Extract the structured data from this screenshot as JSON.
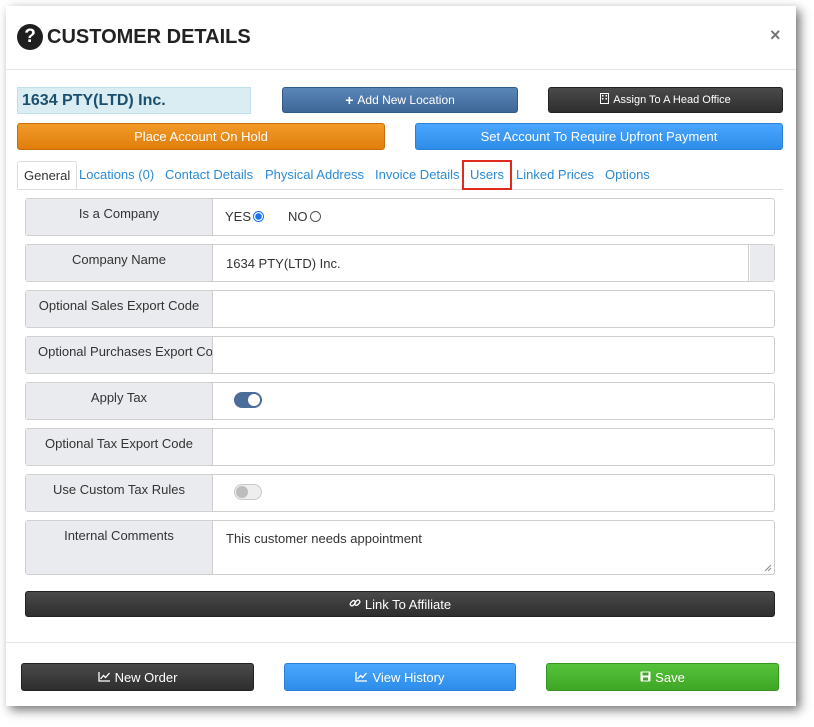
{
  "header": {
    "title": "CUSTOMER DETAILS",
    "close": "×"
  },
  "account_name": "1634 PTY(LTD) Inc.",
  "buttons": {
    "add_location": "Add New Location",
    "assign_head_office": "Assign To A Head Office",
    "place_on_hold": "Place Account On Hold",
    "require_upfront": "Set Account To Require Upfront Payment",
    "link_affiliate": "Link To Affiliate",
    "new_order": "New Order",
    "view_history": "View History",
    "save": "Save"
  },
  "tabs": [
    "General",
    "Locations (0)",
    "Contact Details",
    "Physical Address",
    "Invoice Details",
    "Users",
    "Linked Prices",
    "Options"
  ],
  "form": {
    "is_company": {
      "label": "Is a Company",
      "yes": "YES",
      "no": "NO",
      "selected": "YES"
    },
    "company_name": {
      "label": "Company Name",
      "value": "1634 PTY(LTD) Inc."
    },
    "sales_export": {
      "label": "Optional Sales Export Code",
      "value": ""
    },
    "purchases_export": {
      "label": "Optional Purchases Export Co",
      "value": ""
    },
    "apply_tax": {
      "label": "Apply Tax",
      "on": true
    },
    "tax_export": {
      "label": "Optional Tax Export Code",
      "value": ""
    },
    "custom_tax": {
      "label": "Use Custom Tax Rules",
      "on": false
    },
    "internal_comments": {
      "label": "Internal Comments",
      "value": "This customer needs appointment"
    }
  },
  "colors": {
    "highlight": "#e02a1b",
    "link": "#2a8bd4"
  }
}
